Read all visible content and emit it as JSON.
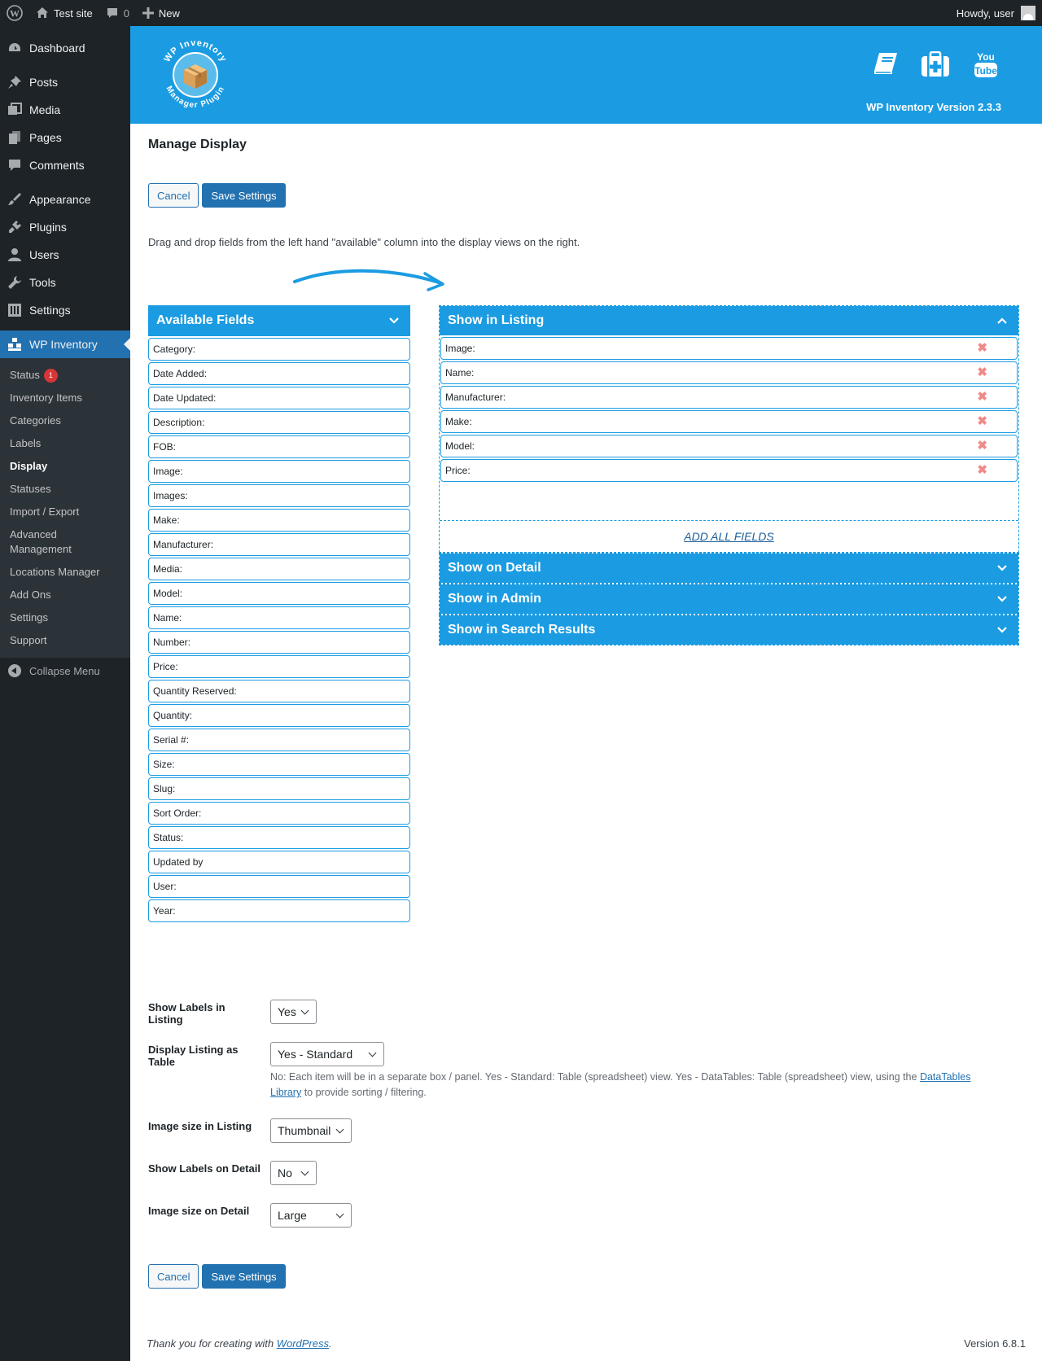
{
  "admin_bar": {
    "site_name": "Test site",
    "comments_count": "0",
    "new_label": "New",
    "howdy": "Howdy, user"
  },
  "sidebar": {
    "menu_top": [
      {
        "label": "Dashboard",
        "icon": "dashboard-icon"
      }
    ],
    "menu_main": [
      {
        "label": "Posts",
        "icon": "pin-icon"
      },
      {
        "label": "Media",
        "icon": "media-icon"
      },
      {
        "label": "Pages",
        "icon": "pages-icon"
      },
      {
        "label": "Comments",
        "icon": "comment-icon"
      }
    ],
    "menu_tools": [
      {
        "label": "Appearance",
        "icon": "brush-icon"
      },
      {
        "label": "Plugins",
        "icon": "plug-icon"
      },
      {
        "label": "Users",
        "icon": "user-icon"
      },
      {
        "label": "Tools",
        "icon": "wrench-icon"
      },
      {
        "label": "Settings",
        "icon": "sliders-icon"
      }
    ],
    "active_menu": {
      "label": "WP Inventory",
      "icon": "inventory-icon"
    },
    "submenu": [
      {
        "label": "Status",
        "badge": "1"
      },
      {
        "label": "Inventory Items"
      },
      {
        "label": "Categories"
      },
      {
        "label": "Labels"
      },
      {
        "label": "Display",
        "current": true
      },
      {
        "label": "Statuses"
      },
      {
        "label": "Import / Export"
      },
      {
        "label": "Advanced Management"
      },
      {
        "label": "Locations Manager"
      },
      {
        "label": "Add Ons"
      },
      {
        "label": "Settings"
      },
      {
        "label": "Support"
      }
    ],
    "collapse_label": "Collapse Menu"
  },
  "banner": {
    "logo_text": "WP Inventory Manager Plugin",
    "version": "WP Inventory Version 2.3.3",
    "accent": "#1b9ce2"
  },
  "page": {
    "title": "Manage Display",
    "cancel_label": "Cancel",
    "save_label": "Save Settings",
    "instructions": "Drag and drop fields from the left hand \"available\" column into the display views on the right."
  },
  "available": {
    "title": "Available Fields",
    "fields": [
      "Category:",
      "Date Added:",
      "Date Updated:",
      "Description:",
      "FOB:",
      "Image:",
      "Images:",
      "Make:",
      "Manufacturer:",
      "Media:",
      "Model:",
      "Name:",
      "Number:",
      "Price:",
      "Quantity Reserved:",
      "Quantity:",
      "Serial #:",
      "Size:",
      "Slug:",
      "Sort Order:",
      "Status:",
      "Updated by",
      "User:",
      "Year:"
    ]
  },
  "listing": {
    "title": "Show in Listing",
    "fields": [
      "Image:",
      "Name:",
      "Manufacturer:",
      "Make:",
      "Model:",
      "Price:"
    ],
    "remove_glyph": "✖",
    "add_all": "ADD ALL FIELDS"
  },
  "collapsed_sections": [
    "Show on Detail",
    "Show in Admin",
    "Show in Search Results"
  ],
  "settings": {
    "show_labels_listing": {
      "label": "Show Labels in Listing",
      "value": "Yes"
    },
    "display_table": {
      "label": "Display Listing as Table",
      "value": "Yes - Standard"
    },
    "display_table_desc_1": "No: Each item will be in a separate box / panel. Yes - Standard: Table (spreadsheet) view. Yes - DataTables: Table (spreadsheet) view, using the ",
    "display_table_link": "DataTables Library",
    "display_table_desc_2": " to provide sorting / filtering.",
    "image_size_listing": {
      "label": "Image size in Listing",
      "value": "Thumbnail"
    },
    "show_labels_detail": {
      "label": "Show Labels on Detail",
      "value": "No"
    },
    "image_size_detail": {
      "label": "Image size on Detail",
      "value": "Large"
    }
  },
  "footer": {
    "thanks_prefix": "Thank you for creating with ",
    "wordpress": "WordPress",
    "thanks_suffix": ".",
    "version": "Version 6.8.1"
  }
}
